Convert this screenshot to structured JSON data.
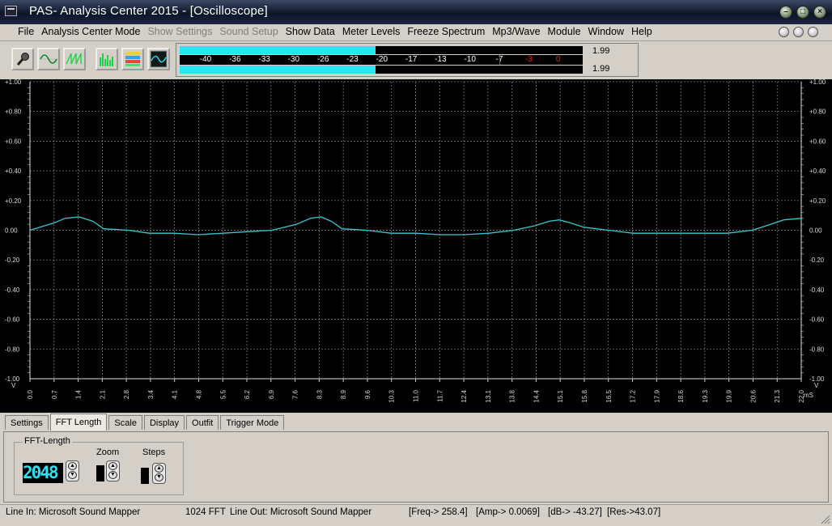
{
  "window": {
    "title": "PAS- Analysis Center 2015 - [Oscilloscope]"
  },
  "menu": {
    "items": [
      {
        "label": "File",
        "enabled": true
      },
      {
        "label": "Analysis Center Mode",
        "enabled": true
      },
      {
        "label": "Show Settings",
        "enabled": false
      },
      {
        "label": "Sound Setup",
        "enabled": false
      },
      {
        "label": "Show Data",
        "enabled": true
      },
      {
        "label": "Meter Levels",
        "enabled": true
      },
      {
        "label": "Freeze Spectrum",
        "enabled": true
      },
      {
        "label": "Mp3/Wave",
        "enabled": true
      },
      {
        "label": "Module",
        "enabled": true
      },
      {
        "label": "Window",
        "enabled": true
      },
      {
        "label": "Help",
        "enabled": true
      }
    ]
  },
  "toolbar": {
    "buttons": [
      "microphone-icon",
      "sine-wave-icon",
      "sawtooth-wave-icon",
      "spectrum-icon",
      "spectrogram-icon",
      "oscilloscope-icon"
    ]
  },
  "meter": {
    "scale": [
      "-40",
      "-36",
      "-33",
      "-30",
      "-26",
      "-23",
      "-20",
      "-17",
      "-13",
      "-10",
      "-7",
      "-3",
      "0"
    ],
    "left_fill": 0.485,
    "right_fill": 0.485,
    "left_value": "1.99",
    "right_value": "1.99",
    "accent": "#2de3f0"
  },
  "scope": {
    "y_ticks": [
      "+1.00",
      "+0.80",
      "+0.60",
      "+0.40",
      "+0.20",
      "0.00",
      "-0.20",
      "-0.40",
      "-0.60",
      "-0.80",
      "-1.00"
    ],
    "x_ticks": [
      "0.0",
      "0.7",
      "1.4",
      "2.1",
      "2.8",
      "3.4",
      "4.1",
      "4.8",
      "5.5",
      "6.2",
      "6.9",
      "7.6",
      "8.3",
      "8.9",
      "9.6",
      "10.3",
      "11.0",
      "11.7",
      "12.4",
      "13.1",
      "13.8",
      "14.4",
      "15.1",
      "15.8",
      "16.5",
      "17.2",
      "17.9",
      "18.6",
      "19.3",
      "19.9",
      "20.6",
      "21.3",
      "22.0"
    ],
    "y_unit": "V",
    "x_unit": "mS",
    "trace_color": "#39c8d2",
    "grid_color": "#8a8a8a",
    "waveform": [
      [
        0.0,
        0.0
      ],
      [
        0.7,
        0.05
      ],
      [
        1.0,
        0.08
      ],
      [
        1.4,
        0.09
      ],
      [
        1.8,
        0.06
      ],
      [
        2.1,
        0.01
      ],
      [
        2.8,
        0.0
      ],
      [
        3.4,
        -0.02
      ],
      [
        4.1,
        -0.02
      ],
      [
        4.8,
        -0.03
      ],
      [
        5.5,
        -0.02
      ],
      [
        6.2,
        -0.01
      ],
      [
        6.9,
        0.0
      ],
      [
        7.6,
        0.04
      ],
      [
        8.0,
        0.08
      ],
      [
        8.3,
        0.09
      ],
      [
        8.6,
        0.06
      ],
      [
        8.9,
        0.01
      ],
      [
        9.6,
        0.0
      ],
      [
        10.3,
        -0.02
      ],
      [
        11.0,
        -0.02
      ],
      [
        11.7,
        -0.03
      ],
      [
        12.4,
        -0.03
      ],
      [
        13.1,
        -0.02
      ],
      [
        13.8,
        0.0
      ],
      [
        14.4,
        0.03
      ],
      [
        14.8,
        0.06
      ],
      [
        15.1,
        0.07
      ],
      [
        15.4,
        0.05
      ],
      [
        15.8,
        0.02
      ],
      [
        16.5,
        0.0
      ],
      [
        17.2,
        -0.02
      ],
      [
        17.9,
        -0.02
      ],
      [
        18.6,
        -0.02
      ],
      [
        19.3,
        -0.02
      ],
      [
        19.9,
        -0.02
      ],
      [
        20.6,
        0.0
      ],
      [
        21.0,
        0.03
      ],
      [
        21.5,
        0.07
      ],
      [
        22.0,
        0.08
      ]
    ]
  },
  "tabs": {
    "items": [
      "Settings",
      "FFT Length",
      "Scale",
      "Display",
      "Outfit",
      "Trigger Mode"
    ],
    "active": 1
  },
  "fft_panel": {
    "group_label": "FFT-Length",
    "fft_value": "2048",
    "zoom_label": "Zoom",
    "steps_label": "Steps"
  },
  "status": {
    "line_in": "Line In: Microsoft Sound Mapper",
    "fft": "1024 FFT",
    "line_out": "Line Out: Microsoft Sound Mapper",
    "freq": "[Freq->  258.4]",
    "amp": "[Amp-> 0.0069]",
    "db": "[dB-> -43.27]",
    "res": "[Res->43.07]"
  }
}
